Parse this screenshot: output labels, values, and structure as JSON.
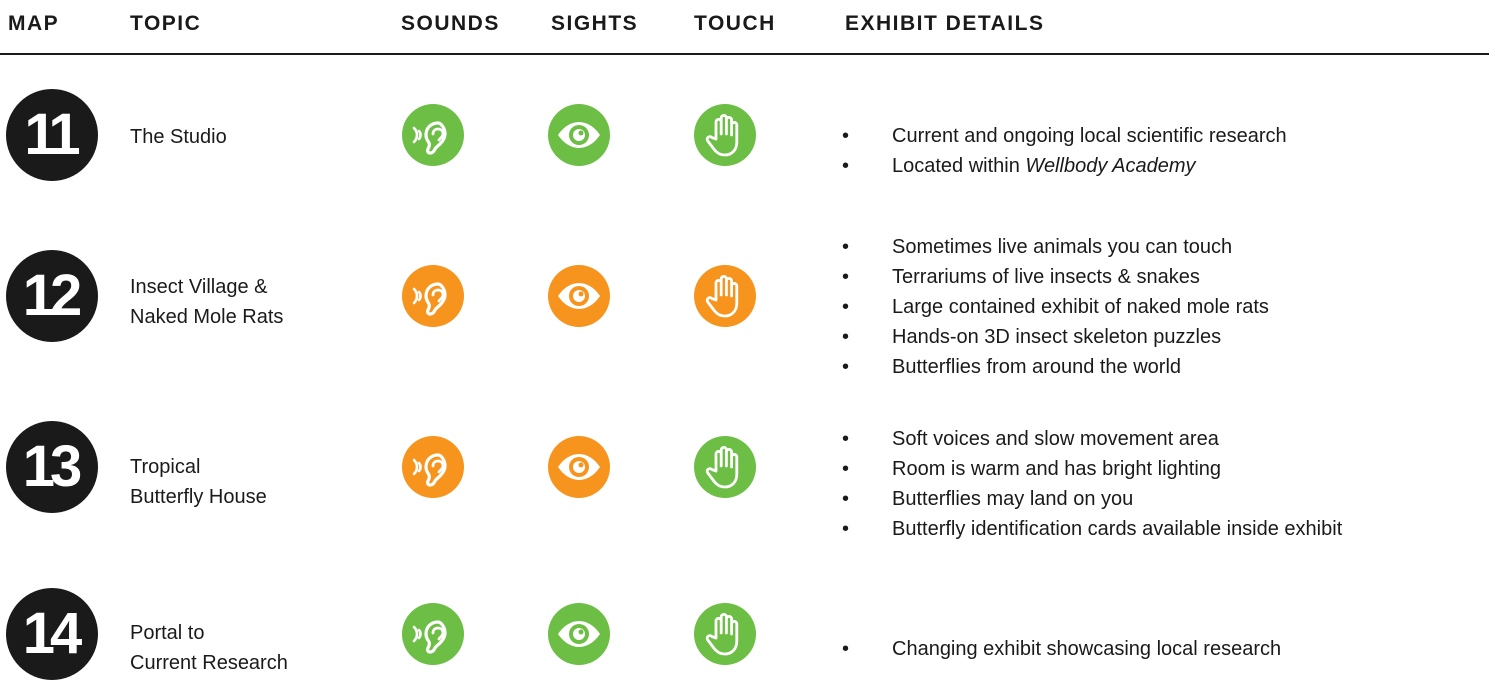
{
  "colors": {
    "green": "#6dbe45",
    "orange": "#f7941d",
    "dark": "#1a1a1a"
  },
  "headers": {
    "map": "MAP",
    "topic": "TOPIC",
    "sounds": "SOUNDS",
    "sights": "SIGHTS",
    "touch": "TOUCH",
    "details": "EXHIBIT DETAILS"
  },
  "rows": [
    {
      "number": "11",
      "topic_lines": [
        "The Studio"
      ],
      "sounds": {
        "icon": "ear-icon",
        "level": "green"
      },
      "sights": {
        "icon": "eye-icon",
        "level": "green"
      },
      "touch": {
        "icon": "hand-icon",
        "level": "green"
      },
      "details": [
        {
          "text": "Current and ongoing local scientific research"
        },
        {
          "prefix": "Located within ",
          "italic": "Wellbody Academy"
        }
      ]
    },
    {
      "number": "12",
      "topic_lines": [
        "Insect Village &",
        "Naked Mole Rats"
      ],
      "sounds": {
        "icon": "ear-icon",
        "level": "orange"
      },
      "sights": {
        "icon": "eye-icon",
        "level": "orange"
      },
      "touch": {
        "icon": "hand-icon",
        "level": "orange"
      },
      "details": [
        {
          "text": "Sometimes live animals you can touch"
        },
        {
          "text": "Terrariums of live insects & snakes"
        },
        {
          "text": "Large contained exhibit of naked mole rats"
        },
        {
          "text": "Hands-on 3D insect skeleton puzzles"
        },
        {
          "text": "Butterflies from around the world"
        }
      ]
    },
    {
      "number": "13",
      "topic_lines": [
        "Tropical",
        "Butterfly House"
      ],
      "sounds": {
        "icon": "ear-icon",
        "level": "orange"
      },
      "sights": {
        "icon": "eye-icon",
        "level": "orange"
      },
      "touch": {
        "icon": "hand-icon",
        "level": "green"
      },
      "details": [
        {
          "text": "Soft voices and slow movement area"
        },
        {
          "text": "Room is warm and has bright lighting"
        },
        {
          "text": "Butterflies may land on you"
        },
        {
          "text": "Butterfly identification cards available inside exhibit"
        }
      ]
    },
    {
      "number": "14",
      "topic_lines": [
        "Portal to",
        "Current Research"
      ],
      "sounds": {
        "icon": "ear-icon",
        "level": "green"
      },
      "sights": {
        "icon": "eye-icon",
        "level": "green"
      },
      "touch": {
        "icon": "hand-icon",
        "level": "green"
      },
      "details": [
        {
          "text": "Changing exhibit showcasing local research"
        }
      ]
    }
  ]
}
